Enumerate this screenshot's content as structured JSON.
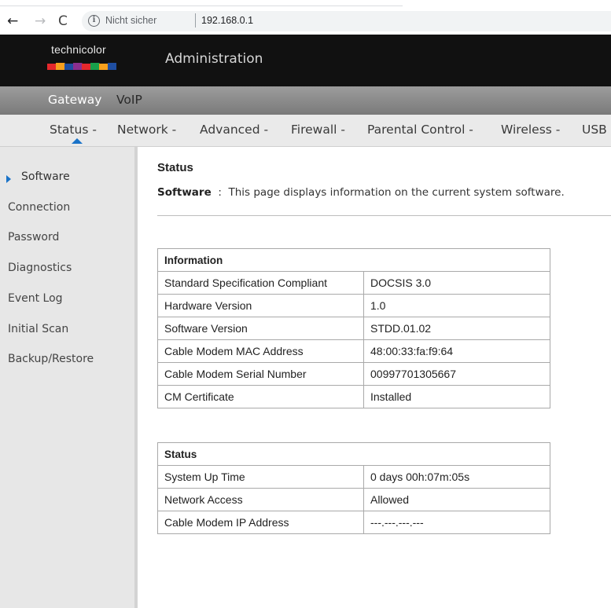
{
  "browser": {
    "back_icon": "←",
    "forward_icon": "→",
    "reload_icon": "C",
    "info_icon": "i",
    "security_label": "Nicht sicher",
    "url": "192.168.0.1"
  },
  "header": {
    "logo_text": "technicolor",
    "title": "Administration",
    "logo_colors": [
      "#e5282c",
      "#f7a01d",
      "#1f4ea1",
      "#8b2f8f",
      "#e5282c",
      "#19a04b",
      "#f7a01d",
      "#1f4ea1"
    ]
  },
  "top_nav": {
    "items": [
      {
        "label": "Gateway",
        "active": true
      },
      {
        "label": "VoIP",
        "active": false
      }
    ]
  },
  "sub_nav": {
    "items": [
      {
        "label": "Status -",
        "active": true
      },
      {
        "label": "Network -",
        "active": false
      },
      {
        "label": "Advanced -",
        "active": false
      },
      {
        "label": "Firewall -",
        "active": false
      },
      {
        "label": "Parental Control -",
        "active": false
      },
      {
        "label": "Wireless -",
        "active": false
      },
      {
        "label": "USB",
        "active": false
      }
    ],
    "active_marker_color": "#1a73c8"
  },
  "sidebar": {
    "items": [
      {
        "label": "Software",
        "active": true
      },
      {
        "label": "Connection",
        "active": false
      },
      {
        "label": "Password",
        "active": false
      },
      {
        "label": "Diagnostics",
        "active": false
      },
      {
        "label": "Event Log",
        "active": false
      },
      {
        "label": "Initial Scan",
        "active": false
      },
      {
        "label": "Backup/Restore",
        "active": false
      }
    ],
    "active_color": "#1a73c8"
  },
  "main": {
    "title": "Status",
    "desc_label": "Software",
    "desc_separator": ":",
    "desc_text": "This page displays information on the current system software.",
    "info_table": {
      "heading": "Information",
      "rows": [
        {
          "key": "Standard Specification Compliant",
          "value": "DOCSIS 3.0"
        },
        {
          "key": "Hardware Version",
          "value": "1.0"
        },
        {
          "key": "Software Version",
          "value": "STDD.01.02"
        },
        {
          "key": "Cable Modem MAC Address",
          "value": "48:00:33:fa:f9:64"
        },
        {
          "key": "Cable Modem Serial Number",
          "value": "00997701305667"
        },
        {
          "key": "CM Certificate",
          "value": "Installed"
        }
      ]
    },
    "status_table": {
      "heading": "Status",
      "rows": [
        {
          "key": "System Up Time",
          "value": "0 days 00h:07m:05s"
        },
        {
          "key": "Network Access",
          "value": "Allowed"
        },
        {
          "key": "Cable Modem IP Address",
          "value": "---.---.---.---"
        }
      ]
    }
  }
}
